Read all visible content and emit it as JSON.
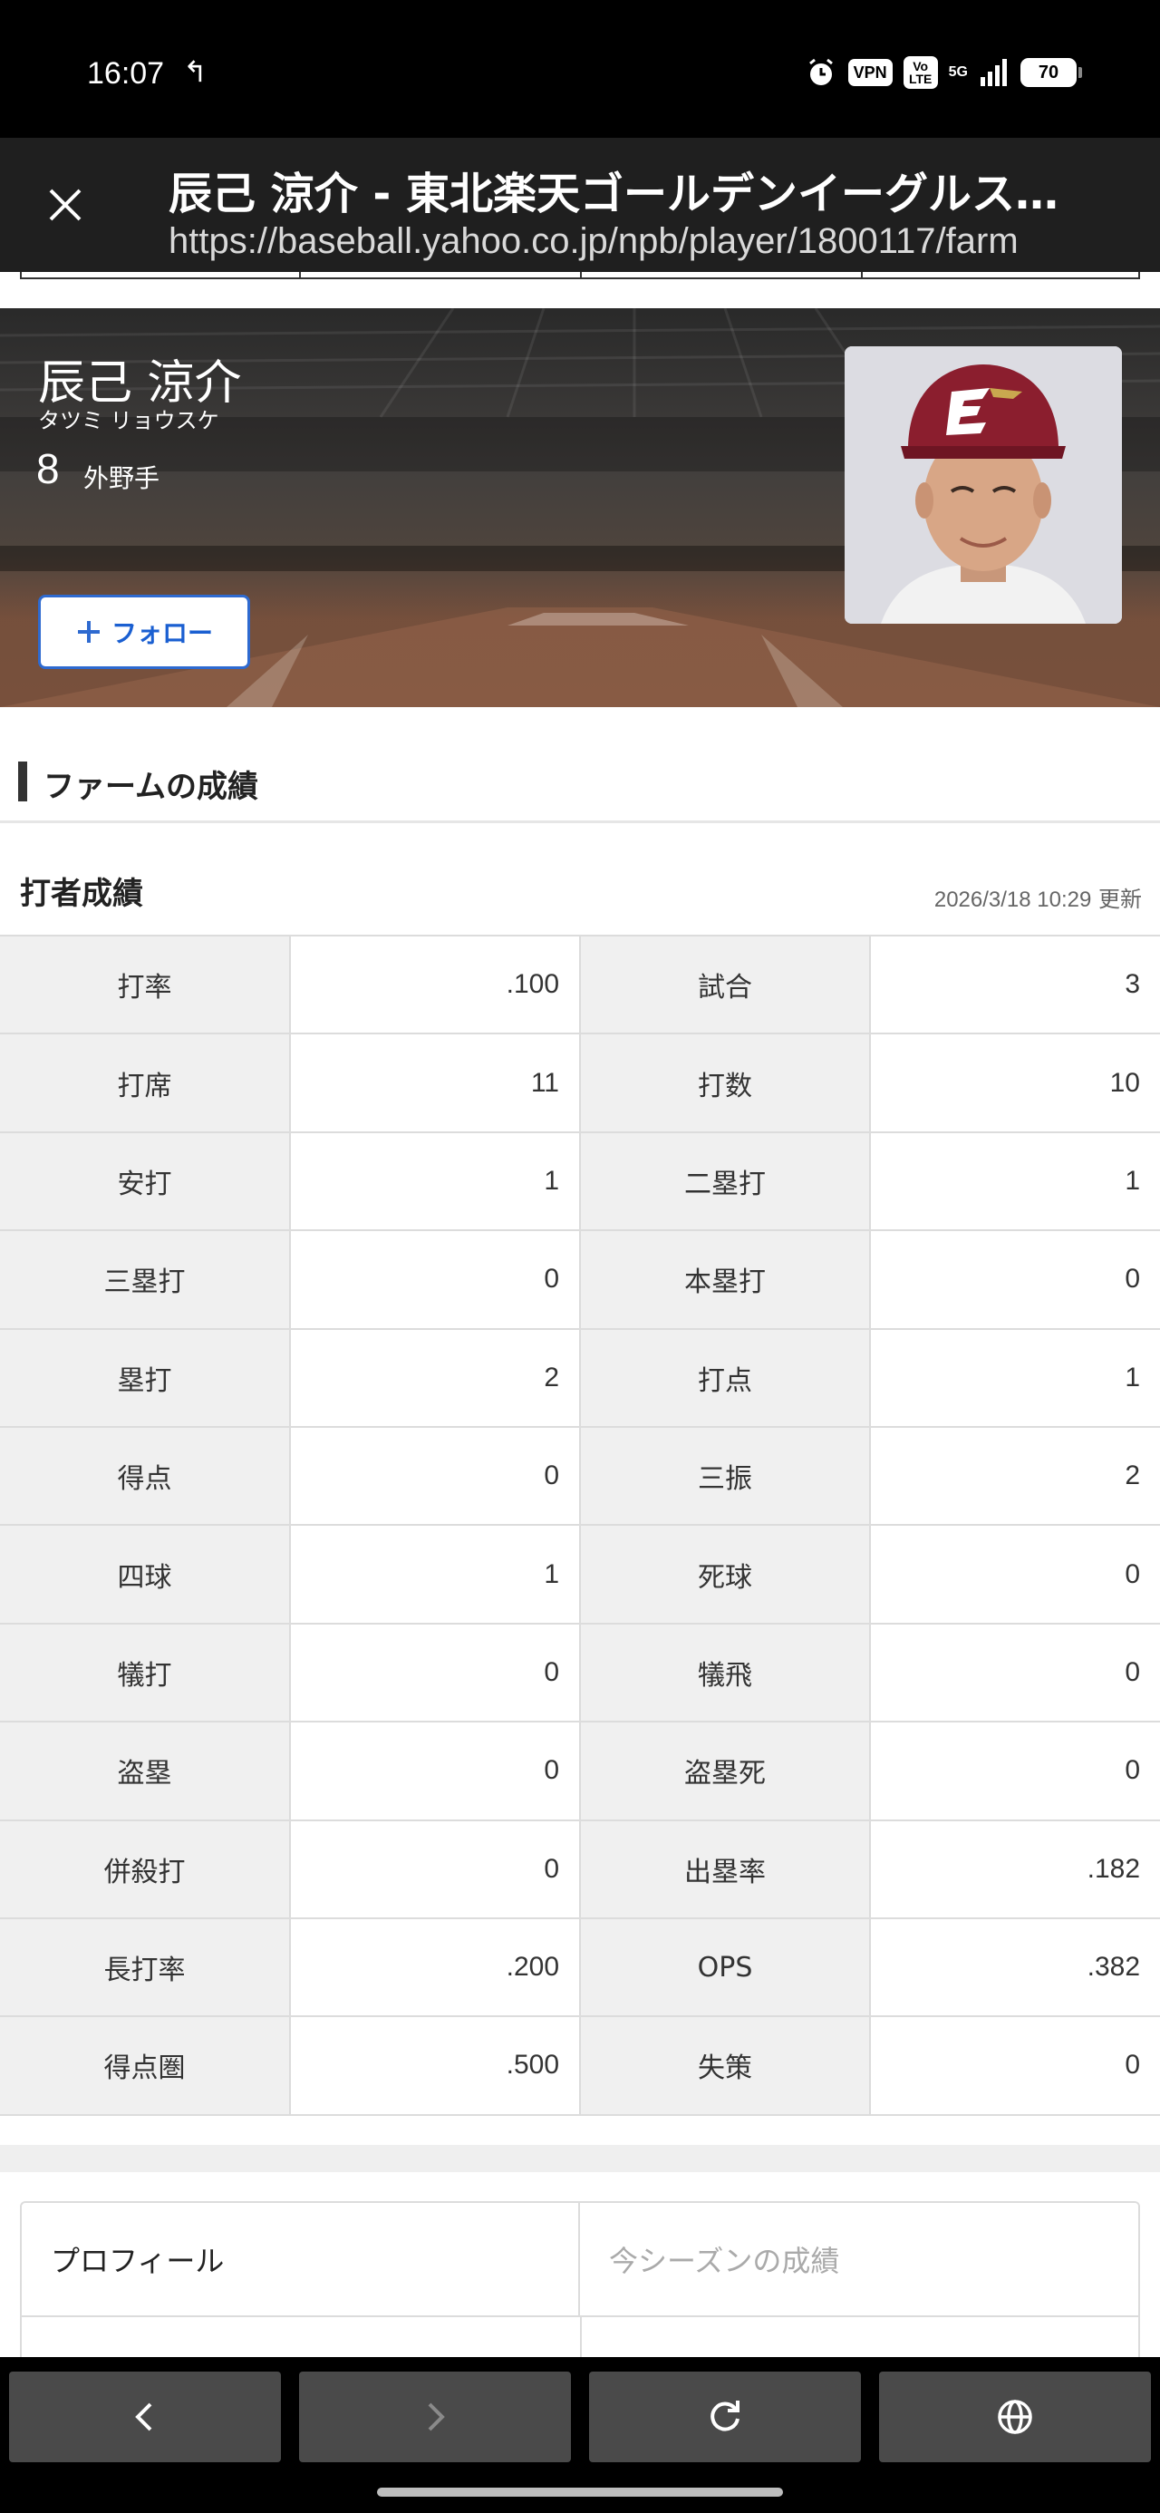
{
  "status_bar": {
    "time": "16:07",
    "back_glyph": "↰",
    "vpn": "VPN",
    "volte": "Vo LTE",
    "network": "5G",
    "battery": "70"
  },
  "browser": {
    "title": "辰己 涼介 - 東北楽天ゴールデンイーグルス…",
    "url": "https://baseball.yahoo.co.jp/npb/player/1800117/farm"
  },
  "player": {
    "name": "辰己 涼介",
    "kana": "タツミ リョウスケ",
    "number": "8",
    "position": "外野手",
    "follow_label": "フォロー"
  },
  "section": {
    "title": "ファームの成績",
    "subtitle": "打者成績",
    "updated_date": "2026/3/18 10:29",
    "updated_suffix": "更新"
  },
  "stats": [
    {
      "l1": "打率",
      "v1": ".100",
      "l2": "試合",
      "v2": "3"
    },
    {
      "l1": "打席",
      "v1": "11",
      "l2": "打数",
      "v2": "10"
    },
    {
      "l1": "安打",
      "v1": "1",
      "l2": "二塁打",
      "v2": "1"
    },
    {
      "l1": "三塁打",
      "v1": "0",
      "l2": "本塁打",
      "v2": "0"
    },
    {
      "l1": "塁打",
      "v1": "2",
      "l2": "打点",
      "v2": "1"
    },
    {
      "l1": "得点",
      "v1": "0",
      "l2": "三振",
      "v2": "2"
    },
    {
      "l1": "四球",
      "v1": "1",
      "l2": "死球",
      "v2": "0"
    },
    {
      "l1": "犠打",
      "v1": "0",
      "l2": "犠飛",
      "v2": "0"
    },
    {
      "l1": "盗塁",
      "v1": "0",
      "l2": "盗塁死",
      "v2": "0"
    },
    {
      "l1": "併殺打",
      "v1": "0",
      "l2": "出塁率",
      "v2": ".182"
    },
    {
      "l1": "長打率",
      "v1": ".200",
      "l2": "OPS",
      "v2": ".382"
    },
    {
      "l1": "得点圏",
      "v1": ".500",
      "l2": "失策",
      "v2": "0"
    }
  ],
  "tabs": {
    "profile": "プロフィール",
    "season": "今シーズンの成績"
  },
  "toolbar": {
    "icons": [
      "back-icon",
      "forward-icon",
      "reload-icon",
      "globe-icon"
    ]
  },
  "colors": {
    "follow_blue": "#2e6ad0",
    "cap_red": "#8b1e2e",
    "header_bg": "#1f1f1f"
  }
}
